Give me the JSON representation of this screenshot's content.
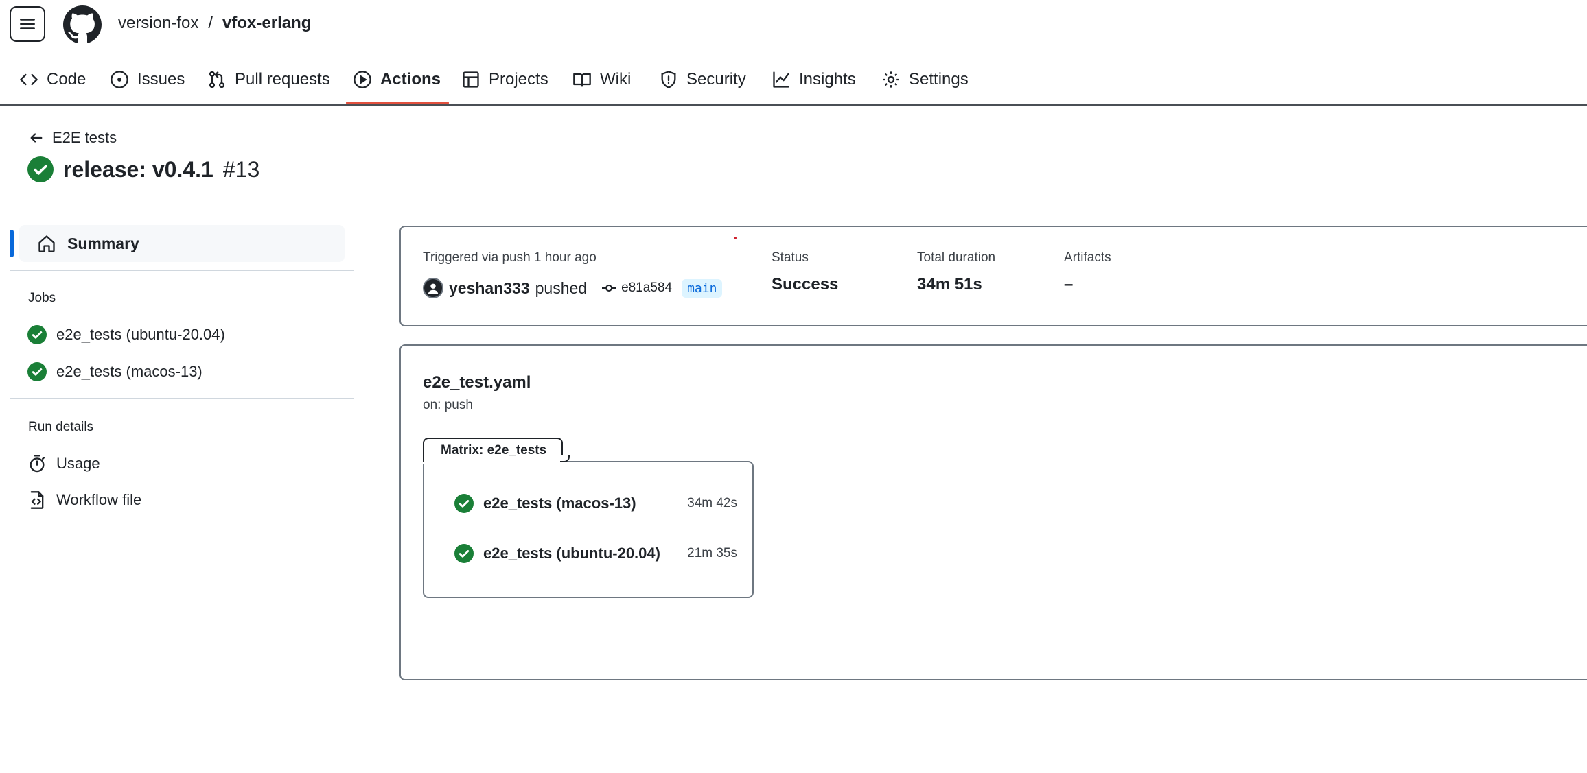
{
  "header": {
    "owner": "version-fox",
    "separator": "/",
    "repo": "vfox-erlang"
  },
  "repo_nav": {
    "tabs": [
      {
        "label": "Code",
        "icon": "code-icon"
      },
      {
        "label": "Issues",
        "icon": "issue-opened-icon"
      },
      {
        "label": "Pull requests",
        "icon": "git-pull-request-icon"
      },
      {
        "label": "Actions",
        "icon": "play-icon",
        "active": true
      },
      {
        "label": "Projects",
        "icon": "table-icon"
      },
      {
        "label": "Wiki",
        "icon": "book-icon"
      },
      {
        "label": "Security",
        "icon": "shield-icon"
      },
      {
        "label": "Insights",
        "icon": "graph-icon"
      },
      {
        "label": "Settings",
        "icon": "gear-icon"
      }
    ]
  },
  "run": {
    "back_label": "E2E tests",
    "title": "release: v0.4.1",
    "number": "#13"
  },
  "sidebar": {
    "summary_label": "Summary",
    "jobs_heading": "Jobs",
    "jobs": [
      {
        "label": "e2e_tests (ubuntu-20.04)"
      },
      {
        "label": "e2e_tests (macos-13)"
      }
    ],
    "run_details_heading": "Run details",
    "details": [
      {
        "label": "Usage",
        "icon": "stopwatch-icon"
      },
      {
        "label": "Workflow file",
        "icon": "file-code-icon"
      }
    ]
  },
  "summary": {
    "trigger_text": "Triggered via push 1 hour ago",
    "actor": "yeshan333",
    "action": "pushed",
    "commit_sha": "e81a584",
    "branch": "main",
    "status_label": "Status",
    "status_value": "Success",
    "duration_label": "Total duration",
    "duration_value": "34m 51s",
    "artifacts_label": "Artifacts",
    "artifacts_value": "–"
  },
  "workflow": {
    "file_name": "e2e_test.yaml",
    "trigger": "on: push",
    "matrix_label": "Matrix: e2e_tests",
    "jobs": [
      {
        "name": "e2e_tests (macos-13)",
        "duration": "34m 42s"
      },
      {
        "name": "e2e_tests (ubuntu-20.04)",
        "duration": "21m 35s"
      }
    ]
  },
  "colors": {
    "success": "#1a7f37",
    "accent_underline": "#e2503e",
    "selected_bar": "#0969da",
    "branch_bg": "#ddf4ff"
  }
}
